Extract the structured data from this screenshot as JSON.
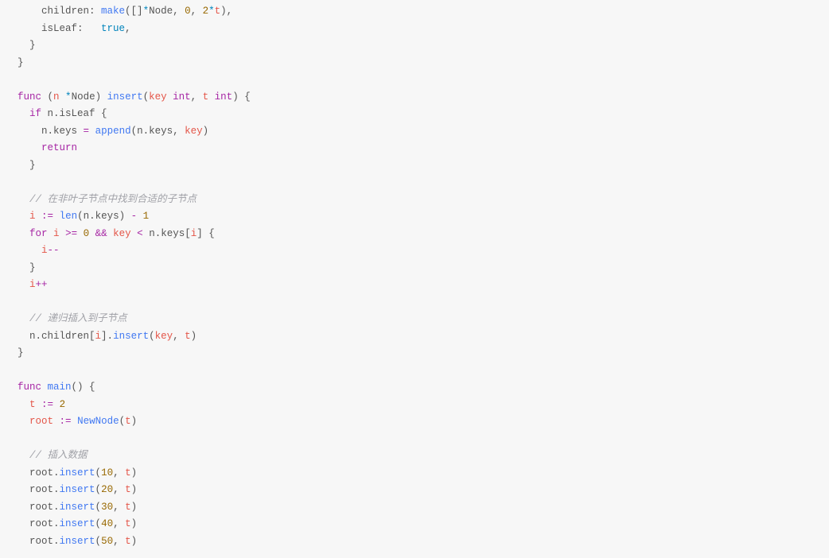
{
  "code": {
    "lines": [
      {
        "indent": "    ",
        "tokens": [
          {
            "t": "children: ",
            "c": "field"
          },
          {
            "t": "make",
            "c": "fn"
          },
          {
            "t": "([]",
            "c": "punct"
          },
          {
            "t": "*",
            "c": "str-op"
          },
          {
            "t": "Node, ",
            "c": "punct"
          },
          {
            "t": "0",
            "c": "num"
          },
          {
            "t": ", ",
            "c": "punct"
          },
          {
            "t": "2",
            "c": "num"
          },
          {
            "t": "*",
            "c": "str-op"
          },
          {
            "t": "t",
            "c": "var"
          },
          {
            "t": "),",
            "c": "punct"
          }
        ],
        "hl": true
      },
      {
        "indent": "    ",
        "tokens": [
          {
            "t": "isLeaf:   ",
            "c": "field"
          },
          {
            "t": "true",
            "c": "lit"
          },
          {
            "t": ",",
            "c": "punct"
          }
        ]
      },
      {
        "indent": "  ",
        "tokens": [
          {
            "t": "}",
            "c": "punct"
          }
        ]
      },
      {
        "indent": "",
        "tokens": [
          {
            "t": "}",
            "c": "punct"
          }
        ]
      },
      {
        "indent": "",
        "tokens": []
      },
      {
        "indent": "",
        "tokens": [
          {
            "t": "func",
            "c": "kw"
          },
          {
            "t": " (",
            "c": "punct"
          },
          {
            "t": "n ",
            "c": "var"
          },
          {
            "t": "*",
            "c": "str-op"
          },
          {
            "t": "Node) ",
            "c": "punct"
          },
          {
            "t": "insert",
            "c": "fn"
          },
          {
            "t": "(",
            "c": "punct"
          },
          {
            "t": "key ",
            "c": "var"
          },
          {
            "t": "int",
            "c": "type"
          },
          {
            "t": ", ",
            "c": "punct"
          },
          {
            "t": "t ",
            "c": "var"
          },
          {
            "t": "int",
            "c": "type"
          },
          {
            "t": ") {",
            "c": "punct"
          }
        ]
      },
      {
        "indent": "  ",
        "tokens": [
          {
            "t": "if",
            "c": "kw"
          },
          {
            "t": " n.isLeaf {",
            "c": "punct"
          }
        ]
      },
      {
        "indent": "    ",
        "tokens": [
          {
            "t": "n.keys ",
            "c": "punct"
          },
          {
            "t": "=",
            "c": "op"
          },
          {
            "t": " ",
            "c": "punct"
          },
          {
            "t": "append",
            "c": "fn"
          },
          {
            "t": "(n.keys, ",
            "c": "punct"
          },
          {
            "t": "key",
            "c": "var"
          },
          {
            "t": ")",
            "c": "punct"
          }
        ]
      },
      {
        "indent": "    ",
        "tokens": [
          {
            "t": "return",
            "c": "kw"
          }
        ]
      },
      {
        "indent": "  ",
        "tokens": [
          {
            "t": "}",
            "c": "punct"
          }
        ]
      },
      {
        "indent": "",
        "tokens": []
      },
      {
        "indent": "  ",
        "tokens": [
          {
            "t": "// 在非叶子节点中找到合适的子节点",
            "c": "cmt"
          }
        ]
      },
      {
        "indent": "  ",
        "tokens": [
          {
            "t": "i ",
            "c": "var"
          },
          {
            "t": ":=",
            "c": "op"
          },
          {
            "t": " ",
            "c": "punct"
          },
          {
            "t": "len",
            "c": "fn"
          },
          {
            "t": "(n.keys) ",
            "c": "punct"
          },
          {
            "t": "-",
            "c": "op"
          },
          {
            "t": " ",
            "c": "punct"
          },
          {
            "t": "1",
            "c": "num"
          }
        ]
      },
      {
        "indent": "  ",
        "tokens": [
          {
            "t": "for",
            "c": "kw"
          },
          {
            "t": " ",
            "c": "punct"
          },
          {
            "t": "i ",
            "c": "var"
          },
          {
            "t": ">=",
            "c": "op"
          },
          {
            "t": " ",
            "c": "punct"
          },
          {
            "t": "0",
            "c": "num"
          },
          {
            "t": " ",
            "c": "punct"
          },
          {
            "t": "&&",
            "c": "op"
          },
          {
            "t": " ",
            "c": "punct"
          },
          {
            "t": "key ",
            "c": "var"
          },
          {
            "t": "<",
            "c": "op"
          },
          {
            "t": " n.keys[",
            "c": "punct"
          },
          {
            "t": "i",
            "c": "var"
          },
          {
            "t": "] {",
            "c": "punct"
          }
        ]
      },
      {
        "indent": "    ",
        "tokens": [
          {
            "t": "i",
            "c": "var"
          },
          {
            "t": "--",
            "c": "op"
          }
        ]
      },
      {
        "indent": "  ",
        "tokens": [
          {
            "t": "}",
            "c": "punct"
          }
        ]
      },
      {
        "indent": "  ",
        "tokens": [
          {
            "t": "i",
            "c": "var"
          },
          {
            "t": "++",
            "c": "op"
          }
        ]
      },
      {
        "indent": "",
        "tokens": []
      },
      {
        "indent": "  ",
        "tokens": [
          {
            "t": "// 递归插入到子节点",
            "c": "cmt"
          }
        ]
      },
      {
        "indent": "  ",
        "tokens": [
          {
            "t": "n.children[",
            "c": "punct"
          },
          {
            "t": "i",
            "c": "var"
          },
          {
            "t": "].",
            "c": "punct"
          },
          {
            "t": "insert",
            "c": "fn"
          },
          {
            "t": "(",
            "c": "punct"
          },
          {
            "t": "key",
            "c": "var"
          },
          {
            "t": ", ",
            "c": "punct"
          },
          {
            "t": "t",
            "c": "var"
          },
          {
            "t": ")",
            "c": "punct"
          }
        ]
      },
      {
        "indent": "",
        "tokens": [
          {
            "t": "}",
            "c": "punct"
          }
        ]
      },
      {
        "indent": "",
        "tokens": []
      },
      {
        "indent": "",
        "tokens": [
          {
            "t": "func",
            "c": "kw"
          },
          {
            "t": " ",
            "c": "punct"
          },
          {
            "t": "main",
            "c": "fn"
          },
          {
            "t": "() {",
            "c": "punct"
          }
        ]
      },
      {
        "indent": "  ",
        "tokens": [
          {
            "t": "t ",
            "c": "var"
          },
          {
            "t": ":=",
            "c": "op"
          },
          {
            "t": " ",
            "c": "punct"
          },
          {
            "t": "2",
            "c": "num"
          }
        ]
      },
      {
        "indent": "  ",
        "tokens": [
          {
            "t": "root ",
            "c": "var"
          },
          {
            "t": ":=",
            "c": "op"
          },
          {
            "t": " ",
            "c": "punct"
          },
          {
            "t": "NewNode",
            "c": "fn"
          },
          {
            "t": "(",
            "c": "punct"
          },
          {
            "t": "t",
            "c": "var"
          },
          {
            "t": ")",
            "c": "punct"
          }
        ]
      },
      {
        "indent": "",
        "tokens": []
      },
      {
        "indent": "  ",
        "tokens": [
          {
            "t": "// 插入数据",
            "c": "cmt"
          }
        ]
      },
      {
        "indent": "  ",
        "tokens": [
          {
            "t": "root.",
            "c": "punct"
          },
          {
            "t": "insert",
            "c": "fn"
          },
          {
            "t": "(",
            "c": "punct"
          },
          {
            "t": "10",
            "c": "num"
          },
          {
            "t": ", ",
            "c": "punct"
          },
          {
            "t": "t",
            "c": "var"
          },
          {
            "t": ")",
            "c": "punct"
          }
        ]
      },
      {
        "indent": "  ",
        "tokens": [
          {
            "t": "root.",
            "c": "punct"
          },
          {
            "t": "insert",
            "c": "fn"
          },
          {
            "t": "(",
            "c": "punct"
          },
          {
            "t": "20",
            "c": "num"
          },
          {
            "t": ", ",
            "c": "punct"
          },
          {
            "t": "t",
            "c": "var"
          },
          {
            "t": ")",
            "c": "punct"
          }
        ]
      },
      {
        "indent": "  ",
        "tokens": [
          {
            "t": "root.",
            "c": "punct"
          },
          {
            "t": "insert",
            "c": "fn"
          },
          {
            "t": "(",
            "c": "punct"
          },
          {
            "t": "30",
            "c": "num"
          },
          {
            "t": ", ",
            "c": "punct"
          },
          {
            "t": "t",
            "c": "var"
          },
          {
            "t": ")",
            "c": "punct"
          }
        ]
      },
      {
        "indent": "  ",
        "tokens": [
          {
            "t": "root.",
            "c": "punct"
          },
          {
            "t": "insert",
            "c": "fn"
          },
          {
            "t": "(",
            "c": "punct"
          },
          {
            "t": "40",
            "c": "num"
          },
          {
            "t": ", ",
            "c": "punct"
          },
          {
            "t": "t",
            "c": "var"
          },
          {
            "t": ")",
            "c": "punct"
          }
        ]
      },
      {
        "indent": "  ",
        "tokens": [
          {
            "t": "root.",
            "c": "punct"
          },
          {
            "t": "insert",
            "c": "fn"
          },
          {
            "t": "(",
            "c": "punct"
          },
          {
            "t": "50",
            "c": "num"
          },
          {
            "t": ", ",
            "c": "punct"
          },
          {
            "t": "t",
            "c": "var"
          },
          {
            "t": ")",
            "c": "punct"
          }
        ]
      }
    ]
  }
}
